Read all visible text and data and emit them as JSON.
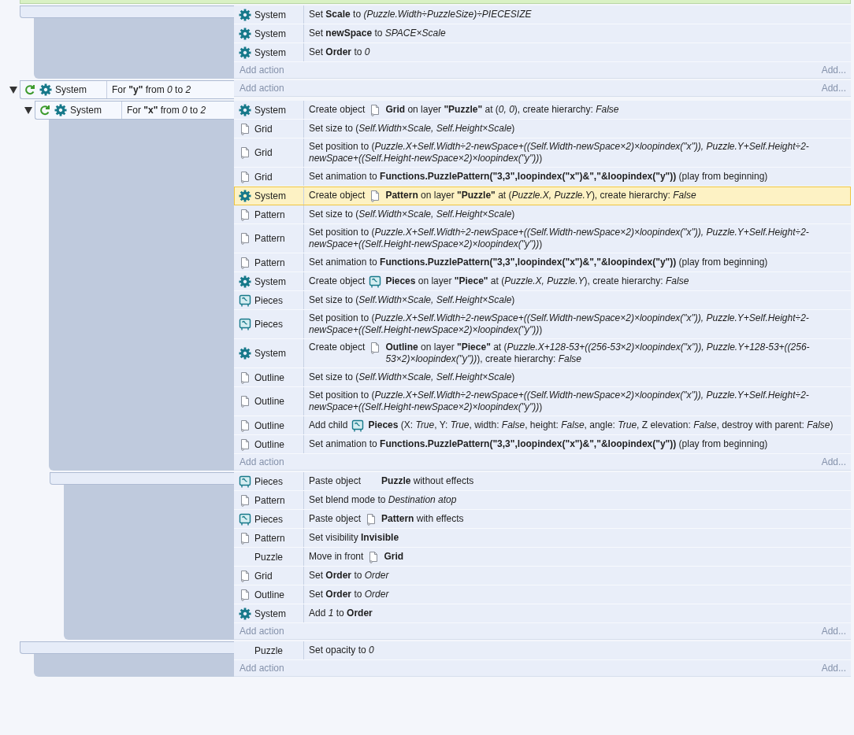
{
  "events": [
    {
      "actions": [
        {
          "object": "System",
          "kind": "gear",
          "selected": false,
          "parts": [
            {
              "text": "Set **Scale** to *(Puzzle.Width÷PuzzleSize)÷PIECESIZE*"
            }
          ]
        },
        {
          "object": "System",
          "kind": "gear",
          "selected": false,
          "parts": [
            {
              "text": "Set **newSpace** to *SPACE×Scale*"
            }
          ]
        },
        {
          "object": "System",
          "kind": "gear",
          "selected": false,
          "parts": [
            {
              "text": "Set **Order** to *0*"
            }
          ]
        }
      ],
      "add_action": "Add action",
      "add_more": "Add..."
    },
    {
      "expanded": true,
      "conditions": [
        {
          "kind": "loop",
          "object": "System",
          "text": "For **\"y\"** from *0* to *2*"
        }
      ],
      "add_action": "Add action",
      "add_more": "Add...",
      "children": [
        {
          "expanded": true,
          "conditions": [
            {
              "kind": "loop",
              "object": "System",
              "text": "For **\"x\"** from *0* to *2*"
            }
          ],
          "actions": [
            {
              "object": "System",
              "kind": "gear",
              "selected": false,
              "parts": [
                {
                  "text": "Create object"
                },
                {
                  "kind": "sprite"
                },
                {
                  "text": "**Grid** on layer **\"Puzzle\"** at (*0, 0*), create hierarchy: *False*"
                }
              ]
            },
            {
              "object": "Grid",
              "kind": "sprite",
              "selected": false,
              "parts": [
                {
                  "text": "Set size to (*Self.Width×Scale, Self.Height×Scale*)"
                }
              ]
            },
            {
              "object": "Grid",
              "kind": "sprite",
              "selected": false,
              "parts": [
                {
                  "text": "Set position to (*Puzzle.X+Self.Width÷2-newSpace+((Self.Width-newSpace×2)×loopindex(\"x\")), Puzzle.Y+Self.Height÷2-newSpace+((Self.Height-newSpace×2)×loopindex(\"y\"))*)"
                }
              ]
            },
            {
              "object": "Grid",
              "kind": "sprite",
              "selected": false,
              "parts": [
                {
                  "text": "Set animation to **Functions.PuzzlePattern(\"3,3\",loopindex(\"x\")&\",\"&loopindex(\"y\"))** (play from beginning)"
                }
              ]
            },
            {
              "object": "System",
              "kind": "gear",
              "selected": true,
              "parts": [
                {
                  "text": "Create object"
                },
                {
                  "kind": "sprite"
                },
                {
                  "text": "**Pattern** on layer **\"Puzzle\"** at (*Puzzle.X, Puzzle.Y*), create hierarchy: *False*"
                }
              ]
            },
            {
              "object": "Pattern",
              "kind": "sprite",
              "selected": false,
              "parts": [
                {
                  "text": "Set size to (*Self.Width×Scale, Self.Height×Scale*)"
                }
              ]
            },
            {
              "object": "Pattern",
              "kind": "sprite",
              "selected": false,
              "parts": [
                {
                  "text": "Set position to (*Puzzle.X+Self.Width÷2-newSpace+((Self.Width-newSpace×2)×loopindex(\"x\")), Puzzle.Y+Self.Height÷2-newSpace+((Self.Height-newSpace×2)×loopindex(\"y\"))*)"
                }
              ]
            },
            {
              "object": "Pattern",
              "kind": "sprite",
              "selected": false,
              "parts": [
                {
                  "text": "Set animation to **Functions.PuzzlePattern(\"3,3\",loopindex(\"x\")&\",\"&loopindex(\"y\"))** (play from beginning)"
                }
              ]
            },
            {
              "object": "System",
              "kind": "gear",
              "selected": false,
              "parts": [
                {
                  "text": "Create object"
                },
                {
                  "kind": "easel"
                },
                {
                  "text": "**Pieces** on layer **\"Piece\"** at (*Puzzle.X, Puzzle.Y*), create hierarchy: *False*"
                }
              ]
            },
            {
              "object": "Pieces",
              "kind": "easel",
              "selected": false,
              "parts": [
                {
                  "text": "Set size to (*Self.Width×Scale, Self.Height×Scale*)"
                }
              ]
            },
            {
              "object": "Pieces",
              "kind": "easel",
              "selected": false,
              "parts": [
                {
                  "text": "Set position to (*Puzzle.X+Self.Width÷2-newSpace+((Self.Width-newSpace×2)×loopindex(\"x\")), Puzzle.Y+Self.Height÷2-newSpace+((Self.Height-newSpace×2)×loopindex(\"y\"))*)"
                }
              ]
            },
            {
              "object": "System",
              "kind": "gear",
              "selected": false,
              "parts": [
                {
                  "text": "Create object"
                },
                {
                  "kind": "sprite"
                },
                {
                  "text": "**Outline** on layer **\"Piece\"** at (*Puzzle.X+128-53+((256-53×2)×loopindex(\"x\")), Puzzle.Y+128-53+((256-53×2)×loopindex(\"y\"))*), create hierarchy: *False*"
                }
              ]
            },
            {
              "object": "Outline",
              "kind": "sprite",
              "selected": false,
              "parts": [
                {
                  "text": "Set size to (*Self.Width×Scale, Self.Height×Scale*)"
                }
              ]
            },
            {
              "object": "Outline",
              "kind": "sprite",
              "selected": false,
              "parts": [
                {
                  "text": "Set position to (*Puzzle.X+Self.Width÷2-newSpace+((Self.Width-newSpace×2)×loopindex(\"x\")), Puzzle.Y+Self.Height÷2-newSpace+((Self.Height-newSpace×2)×loopindex(\"y\"))*)"
                }
              ]
            },
            {
              "object": "Outline",
              "kind": "sprite",
              "selected": false,
              "parts": [
                {
                  "text": "Add child"
                },
                {
                  "kind": "easel"
                },
                {
                  "text": "**Pieces** (X: *True*, Y: *True*, width: *False*, height: *False*, angle: *True*, Z elevation: *False*, destroy with parent: *False*)"
                }
              ]
            },
            {
              "object": "Outline",
              "kind": "sprite",
              "selected": false,
              "parts": [
                {
                  "text": "Set animation to **Functions.PuzzlePattern(\"3,3\",loopindex(\"x\")&\",\"&loopindex(\"y\"))** (play from beginning)"
                }
              ]
            }
          ],
          "add_action": "Add action",
          "add_more": "Add...",
          "children": [
            {
              "actions": [
                {
                  "object": "Pieces",
                  "kind": "easel",
                  "selected": false,
                  "parts": [
                    {
                      "text": "Paste object"
                    },
                    {
                      "kind": "blank"
                    },
                    {
                      "text": "**Puzzle** without effects"
                    }
                  ]
                },
                {
                  "object": "Pattern",
                  "kind": "sprite",
                  "selected": false,
                  "parts": [
                    {
                      "text": "Set blend mode to *Destination atop*"
                    }
                  ]
                },
                {
                  "object": "Pieces",
                  "kind": "easel",
                  "selected": false,
                  "parts": [
                    {
                      "text": "Paste object"
                    },
                    {
                      "kind": "sprite"
                    },
                    {
                      "text": "**Pattern** with effects"
                    }
                  ]
                },
                {
                  "object": "Pattern",
                  "kind": "sprite",
                  "selected": false,
                  "parts": [
                    {
                      "text": "Set visibility **Invisible**"
                    }
                  ]
                },
                {
                  "object": "Puzzle",
                  "kind": "blank",
                  "selected": false,
                  "parts": [
                    {
                      "text": "Move in front"
                    },
                    {
                      "kind": "sprite"
                    },
                    {
                      "text": "**Grid**"
                    }
                  ]
                },
                {
                  "object": "Grid",
                  "kind": "sprite",
                  "selected": false,
                  "parts": [
                    {
                      "text": "Set **Order** to *Order*"
                    }
                  ]
                },
                {
                  "object": "Outline",
                  "kind": "sprite",
                  "selected": false,
                  "parts": [
                    {
                      "text": "Set **Order** to *Order*"
                    }
                  ]
                },
                {
                  "object": "System",
                  "kind": "gear",
                  "selected": false,
                  "parts": [
                    {
                      "text": "Add *1* to **Order**"
                    }
                  ]
                }
              ],
              "add_action": "Add action",
              "add_more": "Add..."
            }
          ]
        }
      ]
    },
    {
      "actions": [
        {
          "object": "Puzzle",
          "kind": "blank",
          "selected": false,
          "parts": [
            {
              "text": "Set opacity to *0*"
            }
          ]
        }
      ],
      "add_action": "Add action",
      "add_more": "Add..."
    }
  ]
}
